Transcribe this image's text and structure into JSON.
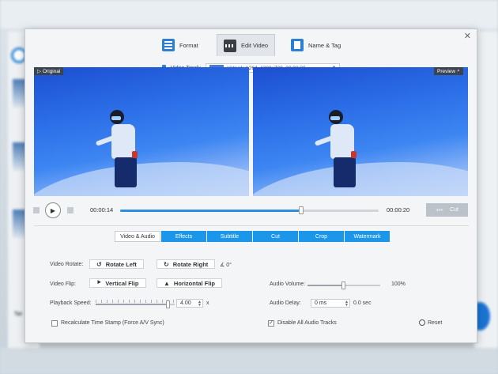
{
  "background": {
    "label": "Tar"
  },
  "tabs": [
    {
      "label": "Format",
      "icon": "format-icon"
    },
    {
      "label": "Edit Video",
      "icon": "edit-video-icon"
    },
    {
      "label": "Name & Tag",
      "icon": "name-tag-icon"
    }
  ],
  "track": {
    "label": "Video Track:",
    "value": "Video1: h264, 1280x720, 00:00:20"
  },
  "preview": {
    "original_label": "Original",
    "preview_label": "Preview"
  },
  "playback": {
    "current_time": "00:00:14",
    "total_time": "00:00:20",
    "cut_label": "Cut",
    "progress": 0.7
  },
  "sub_tabs": [
    "Video & Audio",
    "Effects",
    "Subtitle",
    "Cut",
    "Crop",
    "Watermark"
  ],
  "controls": {
    "rotate_label": "Video Rotate:",
    "rotate_left": "Rotate Left",
    "rotate_right": "Rotate Right",
    "rotate_degree": "0°",
    "flip_label": "Video Flip:",
    "vertical_flip": "Vertical Flip",
    "horizontal_flip": "Horizontal Flip",
    "speed_label": "Playback Speed:",
    "speed_value": "4.00",
    "speed_unit": "x",
    "speed_level": 0.92,
    "volume_label": "Audio Volume:",
    "volume_value": "100%",
    "volume_level": 0.5,
    "delay_label": "Audio Delay:",
    "delay_value": "0 ms",
    "delay_display": "0.0 sec",
    "recalc_label": "Recalculate Time Stamp (Force A/V Sync)",
    "recalc_checked": false,
    "disable_audio_label": "Disable All Audio Tracks",
    "disable_audio_checked": true,
    "reset_label": "Reset"
  },
  "colors": {
    "accent": "#1c96e8",
    "tab_active": "#ffffff"
  }
}
